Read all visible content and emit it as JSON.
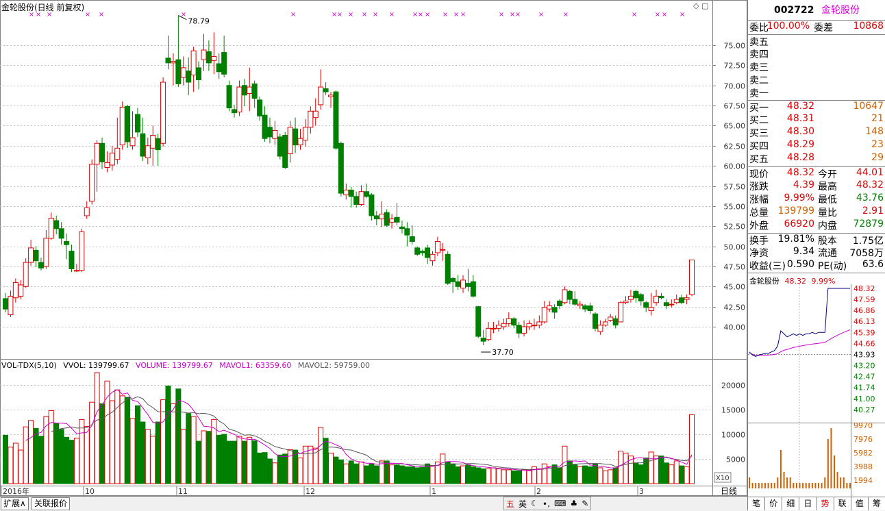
{
  "chart": {
    "title": "金轮股份(日线 前复权)",
    "high_label": "78.79",
    "low_label": "37.70",
    "price_ticks": [
      "75.00",
      "72.50",
      "70.00",
      "67.50",
      "65.00",
      "62.50",
      "60.00",
      "57.50",
      "55.00",
      "52.50",
      "50.00",
      "47.50",
      "45.00",
      "42.50",
      "40.00"
    ],
    "vol_ticks": [
      "20000",
      "15000",
      "10000",
      "5000"
    ],
    "vol_scale": "X10",
    "x_labels": [
      "2016年",
      "10",
      "11",
      "12",
      "1",
      "2",
      "3"
    ],
    "period": "日线"
  },
  "volume": {
    "indicator": "VOL-TDX(5,10)",
    "vvol": "VVOL: 139799.67",
    "volume": "VOLUME: 139799.67",
    "mavol1": "MAVOL1: 63359.60",
    "mavol2": "MAVOL2: 59759.00"
  },
  "bottom_tabs": [
    "扩展∧",
    "关联报价"
  ],
  "ime": [
    "五",
    "英",
    "☾",
    "∙,",
    "⌨",
    "♣",
    "✎"
  ],
  "quote": {
    "code": "002722",
    "name": "金轮股份",
    "weibi_label": "委比",
    "weibi": "100.00%",
    "weicha_label": "委差",
    "weicha": "10868",
    "asks": [
      {
        "label": "卖五"
      },
      {
        "label": "卖四"
      },
      {
        "label": "卖三"
      },
      {
        "label": "卖二"
      },
      {
        "label": "卖一"
      }
    ],
    "bids": [
      {
        "label": "买一",
        "price": "48.32",
        "vol": "10647"
      },
      {
        "label": "买二",
        "price": "48.31",
        "vol": "21"
      },
      {
        "label": "买三",
        "price": "48.30",
        "vol": "148"
      },
      {
        "label": "买四",
        "price": "48.29",
        "vol": "23"
      },
      {
        "label": "买五",
        "price": "48.28",
        "vol": "29"
      }
    ],
    "stats": [
      {
        "l1": "现价",
        "v1": "48.32",
        "l2": "今开",
        "v2": "44.01",
        "c1": "red",
        "c2": "red"
      },
      {
        "l1": "涨跌",
        "v1": "4.39",
        "l2": "最高",
        "v2": "48.32",
        "c1": "red",
        "c2": "red"
      },
      {
        "l1": "涨幅",
        "v1": "9.99%",
        "l2": "最低",
        "v2": "43.76",
        "c1": "red",
        "c2": "green"
      },
      {
        "l1": "总量",
        "v1": "139799",
        "l2": "量比",
        "v2": "2.91",
        "c1": "orange",
        "c2": "red"
      },
      {
        "l1": "外盘",
        "v1": "66920",
        "l2": "内盘",
        "v2": "72879",
        "c1": "red",
        "c2": "green"
      }
    ],
    "finance": [
      {
        "l1": "换手",
        "v1": "19.81%",
        "l2": "股本",
        "v2": "1.75亿"
      },
      {
        "l1": "净资",
        "v1": "9.34",
        "l2": "流通",
        "v2": "7058万"
      },
      {
        "l1": "收益(三)",
        "v1": "0.590",
        "l2": "PE(动)",
        "v2": "63.6"
      }
    ]
  },
  "mini": {
    "name": "金轮股份",
    "price": "48.32",
    "pct": "9.99%",
    "left_ticks": [],
    "right_ticks": [
      "48.32",
      "47.59",
      "46.86",
      "46.13",
      "45.39",
      "44.66",
      "43.93",
      "43.20",
      "42.47",
      "41.74",
      "41.00",
      "40.27"
    ],
    "vol_ticks": [
      "9970",
      "7976",
      "5982",
      "3988",
      "1994"
    ]
  },
  "right_tabs": [
    "笔",
    "价",
    "细",
    "日",
    "势",
    "联",
    "值",
    "筹"
  ],
  "colors": {
    "up": "#e00000",
    "down": "#008000",
    "ma1": "#cc00cc",
    "ma2": "#555555",
    "grid": "#c0c0c0"
  }
}
